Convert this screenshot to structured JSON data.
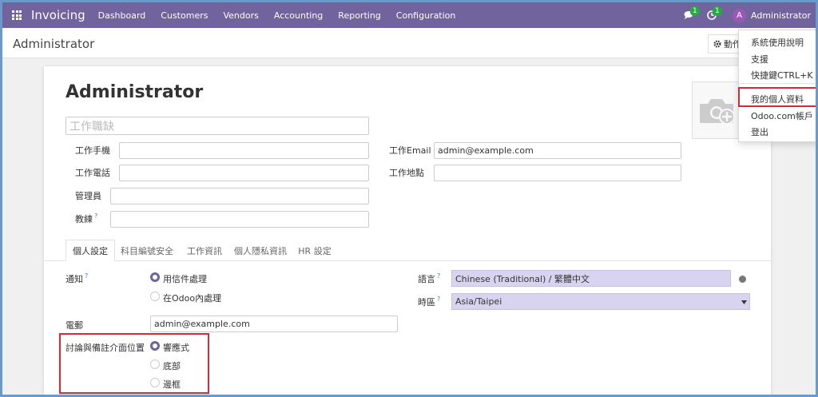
{
  "navbar": {
    "app_name": "Invoicing",
    "menu": [
      "Dashboard",
      "Customers",
      "Vendors",
      "Accounting",
      "Reporting",
      "Configuration"
    ],
    "messages_count": "1",
    "activities_count": "1",
    "user_initial": "A",
    "user_name": "Administrator",
    "bg_color": "#71639e"
  },
  "control_panel": {
    "breadcrumb": "Administrator",
    "action_label": "動作"
  },
  "form": {
    "name": "Administrator",
    "job_title_placeholder": "工作職缺",
    "mobile_label": "工作手機",
    "phone_label": "工作電話",
    "manager_label": "管理員",
    "coach_label": "教練",
    "work_email_label": "工作Email",
    "work_email_value": "admin@example.com",
    "work_location_label": "工作地點",
    "help_mark": "?"
  },
  "tabs": [
    "個人設定",
    "科目編號安全",
    "工作資訊",
    "個人隱私資訊",
    "HR 設定"
  ],
  "preferences": {
    "notification_label": "通知",
    "notification_options": [
      "用信件處理",
      "在Odoo內處理"
    ],
    "notification_selected": "用信件處理",
    "email_label": "電郵",
    "email_value": "admin@example.com",
    "chatter_label": "討論與備註介面位置",
    "chatter_options": [
      "響應式",
      "底部",
      "邊框"
    ],
    "chatter_selected": "響應式",
    "language_label": "語言",
    "language_value": "Chinese (Traditional) / 繁體中文",
    "timezone_label": "時區",
    "timezone_value": "Asia/Taipei"
  },
  "user_menu": {
    "items": [
      "系統使用說明",
      "支援",
      "快捷鍵CTRL+K",
      "我的個人資料",
      "Odoo.com帳戶",
      "登出"
    ],
    "highlighted": "我的個人資料",
    "highlight_color": "#d62b35"
  },
  "icons": [
    "apps-grid-icon",
    "chat-icon",
    "clock-icon",
    "gear-icon",
    "camera-plus-icon",
    "globe-icon",
    "caret-down-icon"
  ]
}
